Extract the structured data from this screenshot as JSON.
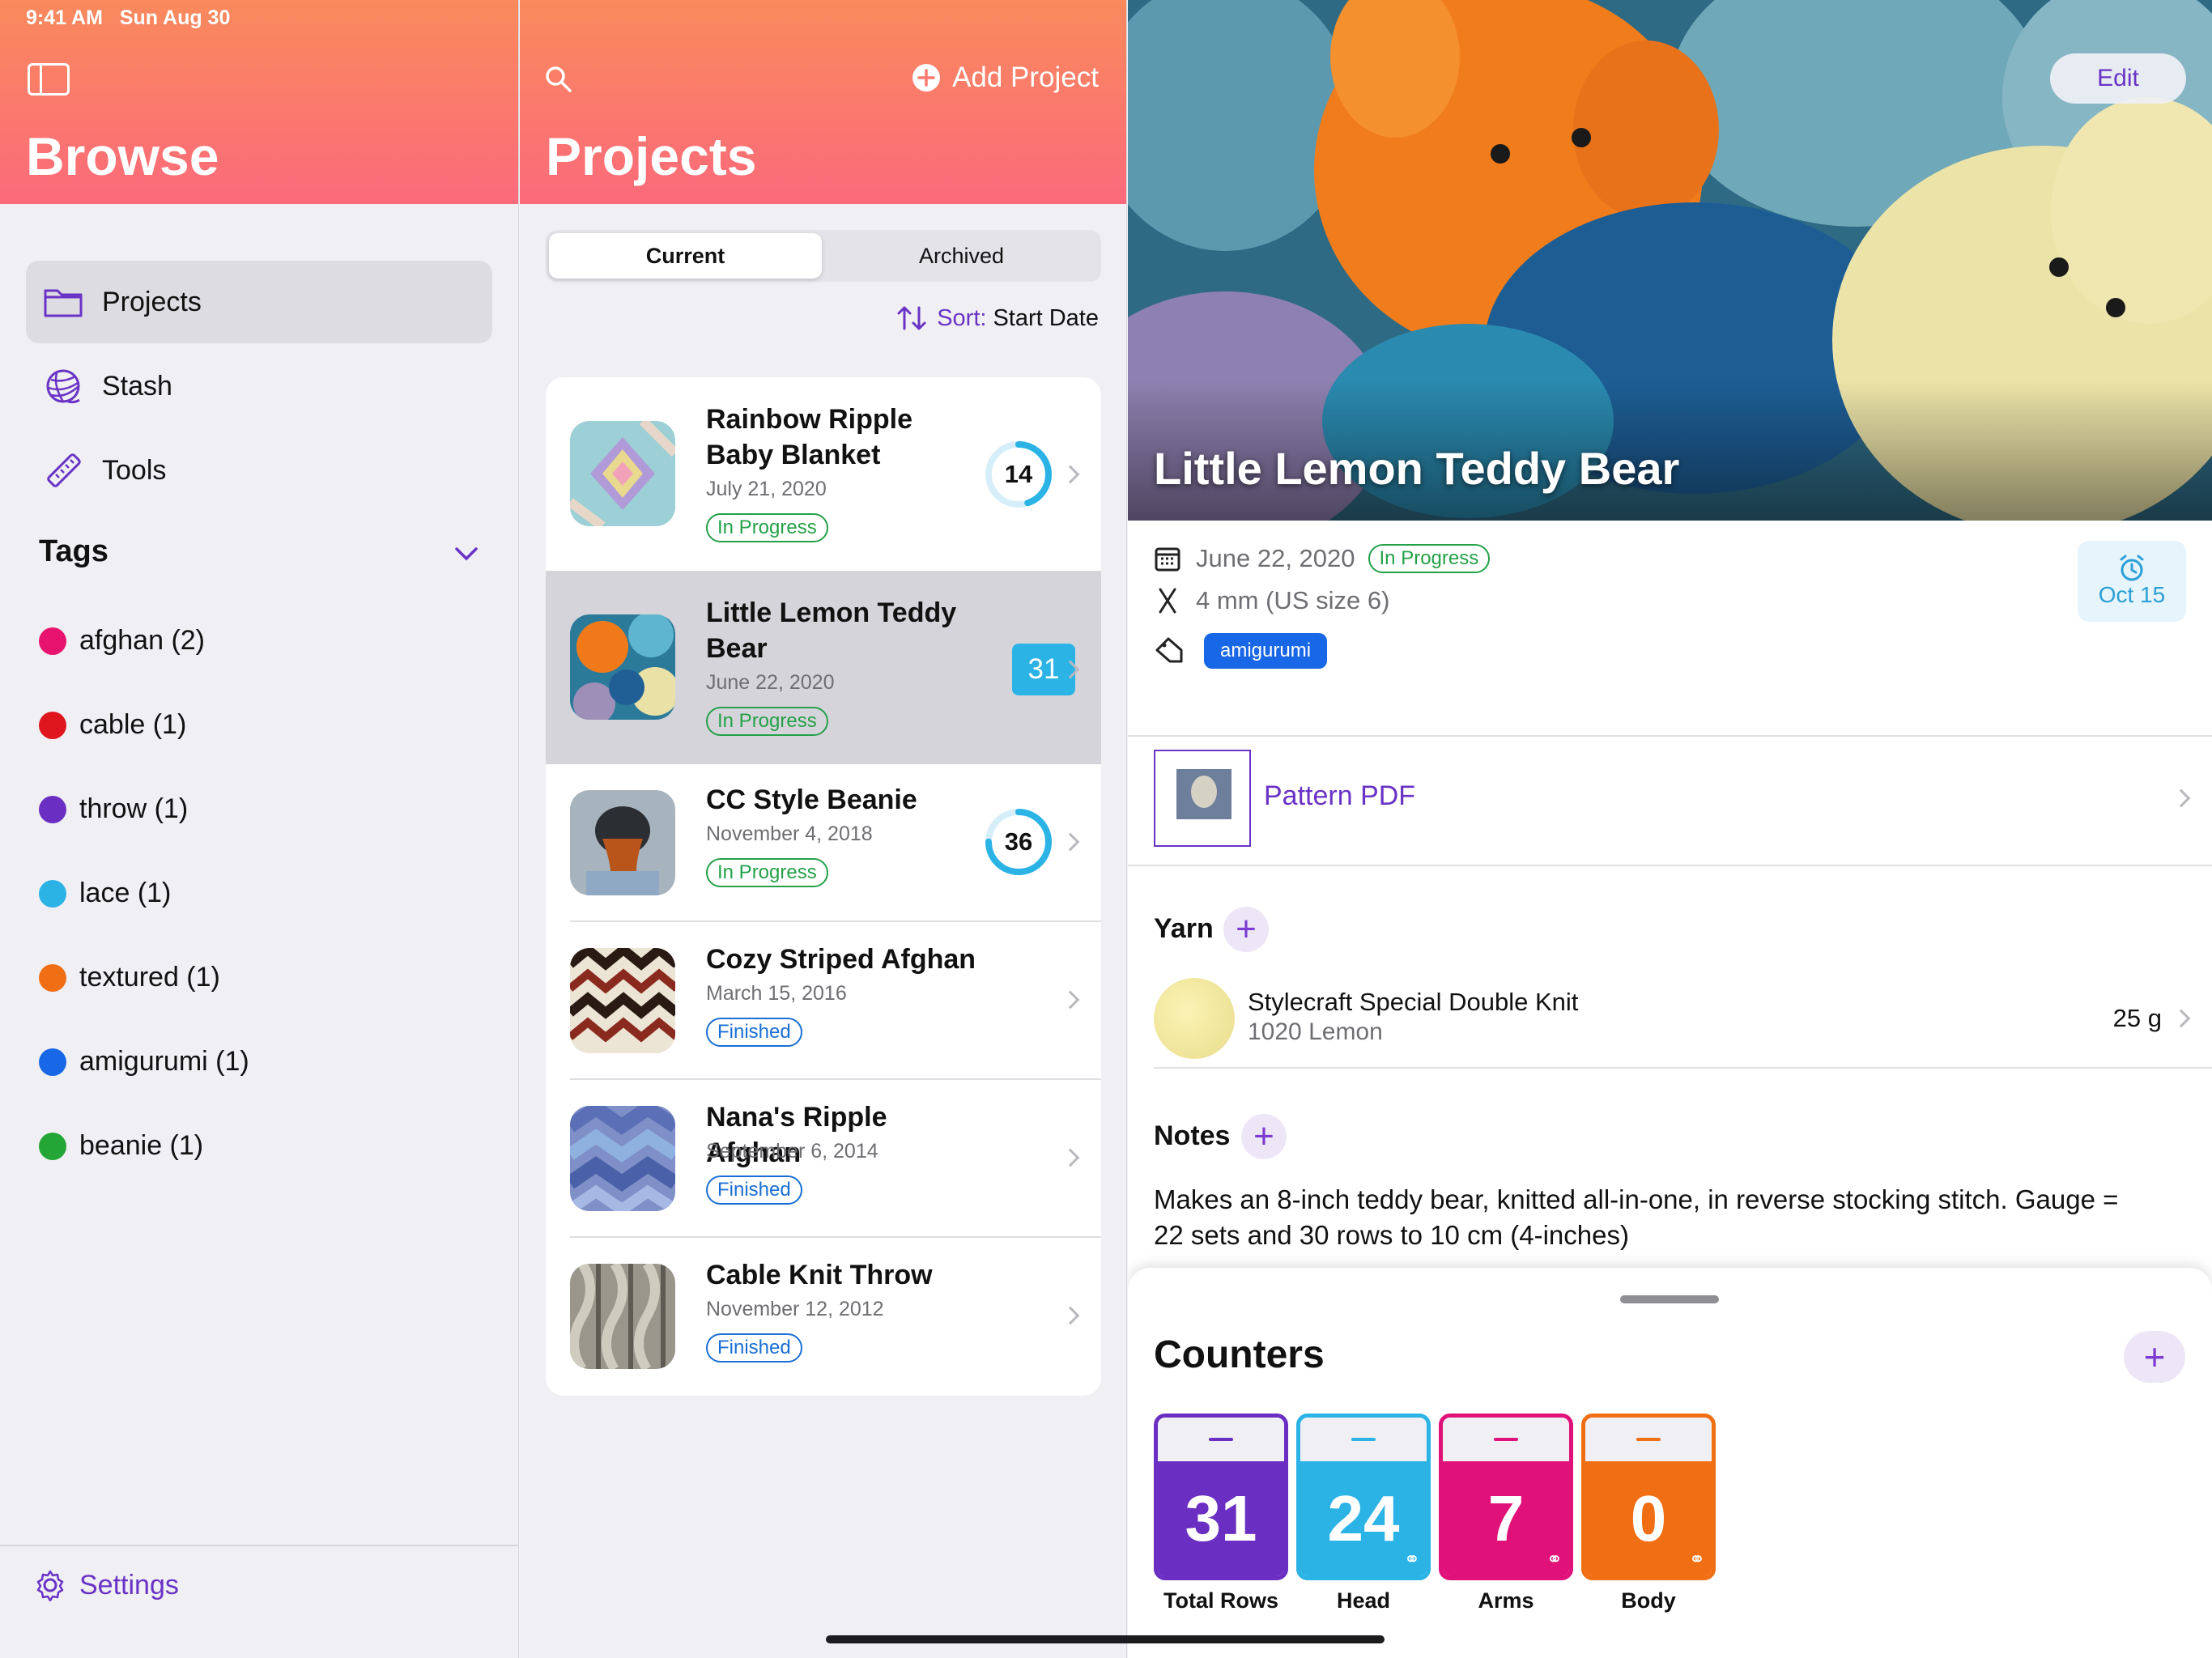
{
  "status_bar": {
    "time": "9:41 AM",
    "date": "Sun Aug 30"
  },
  "browse": {
    "title": "Browse",
    "nav": [
      {
        "label": "Projects",
        "icon": "folder-icon",
        "selected": true
      },
      {
        "label": "Stash",
        "icon": "yarn-ball-icon",
        "selected": false
      },
      {
        "label": "Tools",
        "icon": "ruler-icon",
        "selected": false
      }
    ],
    "tags_header": "Tags",
    "tags": [
      {
        "label": "afghan (2)",
        "color": "#e8126f"
      },
      {
        "label": "cable (1)",
        "color": "#e0161f"
      },
      {
        "label": "throw (1)",
        "color": "#6a2fc2"
      },
      {
        "label": "lace (1)",
        "color": "#2bb3e6"
      },
      {
        "label": "textured (1)",
        "color": "#f06e14"
      },
      {
        "label": "amigurumi (1)",
        "color": "#1867e6"
      },
      {
        "label": "beanie (1)",
        "color": "#23a636"
      }
    ],
    "settings_label": "Settings"
  },
  "projects": {
    "title": "Projects",
    "add_label": "Add Project",
    "segments": {
      "current": "Current",
      "archived": "Archived",
      "selected": "Current"
    },
    "sort_prefix": "Sort:",
    "sort_value": "Start Date",
    "items": [
      {
        "title": "Rainbow Ripple Baby Blanket",
        "date": "July 21, 2020",
        "status": "In Progress",
        "count": "14",
        "count_style": "ring",
        "progress": 0.45,
        "thumb": "rainbow-blanket"
      },
      {
        "title": "Little Lemon Teddy Bear",
        "date": "June 22, 2020",
        "status": "In Progress",
        "count": "31",
        "count_style": "square",
        "thumb": "teddy-bear"
      },
      {
        "title": "CC Style Beanie",
        "date": "November 4, 2018",
        "status": "In Progress",
        "count": "36",
        "count_style": "ring",
        "progress": 0.75,
        "thumb": "beanie"
      },
      {
        "title": "Cozy Striped Afghan",
        "date": "March 15, 2016",
        "status": "Finished",
        "thumb": "striped-afghan"
      },
      {
        "title": "Nana's Ripple Afghan",
        "date": "September 6, 2014",
        "status": "Finished",
        "thumb": "ripple-afghan"
      },
      {
        "title": "Cable Knit Throw",
        "date": "November 12, 2012",
        "status": "Finished",
        "thumb": "cable-throw"
      }
    ]
  },
  "detail": {
    "title": "Little Lemon Teddy Bear",
    "edit_label": "Edit",
    "date": "June 22, 2020",
    "status": "In Progress",
    "needle": "4 mm (US size 6)",
    "tag": "amigurumi",
    "reminder": "Oct 15",
    "pattern_label": "Pattern PDF",
    "yarn_header": "Yarn",
    "yarn": {
      "name": "Stylecraft Special Double Knit",
      "color": "1020 Lemon",
      "weight": "25 g"
    },
    "notes_header": "Notes",
    "notes": "Makes an 8-inch teddy bear, knitted all-in-one, in reverse stocking stitch. Gauge = 22 sets and 30 rows to 10 cm (4-inches)",
    "counters_header": "Counters",
    "counters": [
      {
        "label": "Total Rows",
        "value": "31",
        "color": "#6a2fc2",
        "linked": false
      },
      {
        "label": "Head",
        "value": "24",
        "color": "#2bb3e6",
        "linked": true
      },
      {
        "label": "Arms",
        "value": "7",
        "color": "#e0127a",
        "linked": true
      },
      {
        "label": "Body",
        "value": "0",
        "color": "#f06e14",
        "linked": true
      }
    ]
  },
  "colors": {
    "accent": "#6a33c6",
    "header_top": "#f98a5c",
    "header_bottom": "#fb6a7b",
    "green": "#24a148",
    "blue": "#1a6fd4"
  }
}
